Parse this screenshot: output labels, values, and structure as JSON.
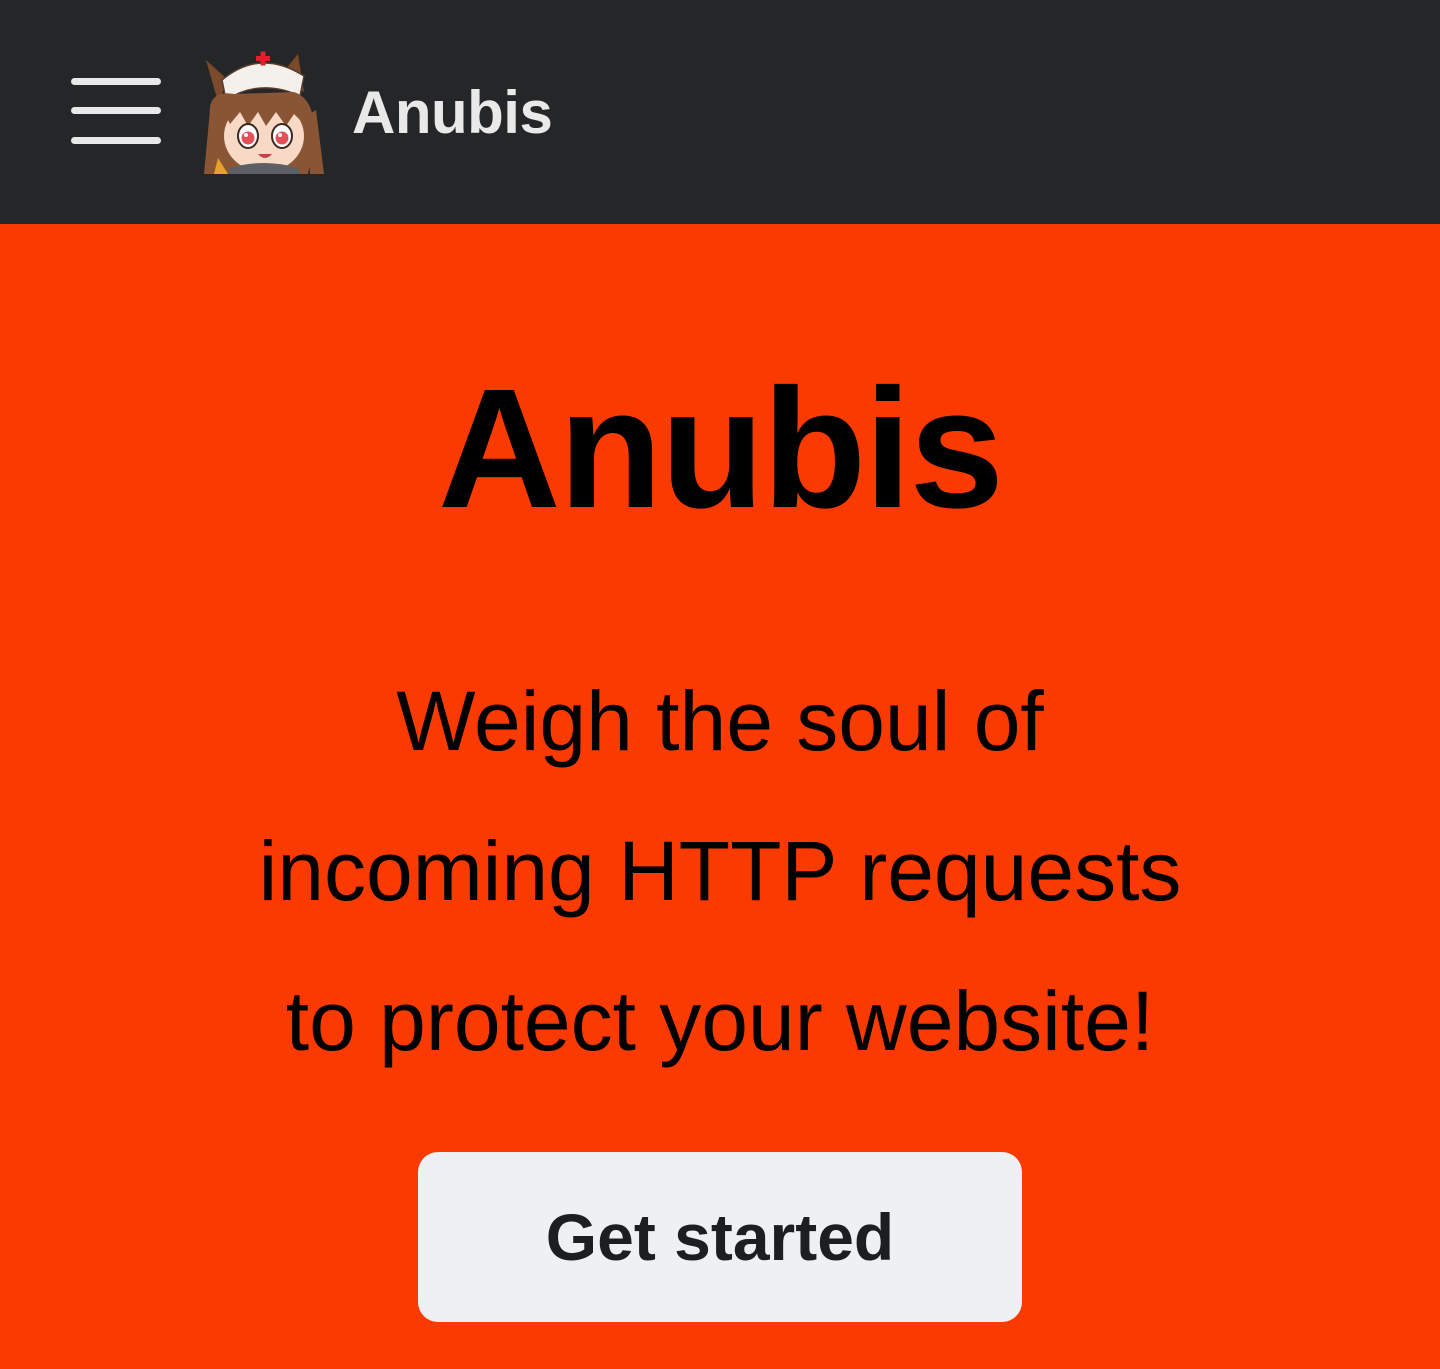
{
  "navbar": {
    "menu_icon": "hamburger-menu-icon",
    "logo_icon": "anubis-mascot-logo",
    "title": "Anubis",
    "background": "#252628"
  },
  "hero": {
    "title": "Anubis",
    "tagline_lines": [
      "Weigh the soul of",
      "incoming HTTP requests",
      "to protect your website!"
    ],
    "cta_label": "Get started",
    "background": "#fa3a00"
  }
}
